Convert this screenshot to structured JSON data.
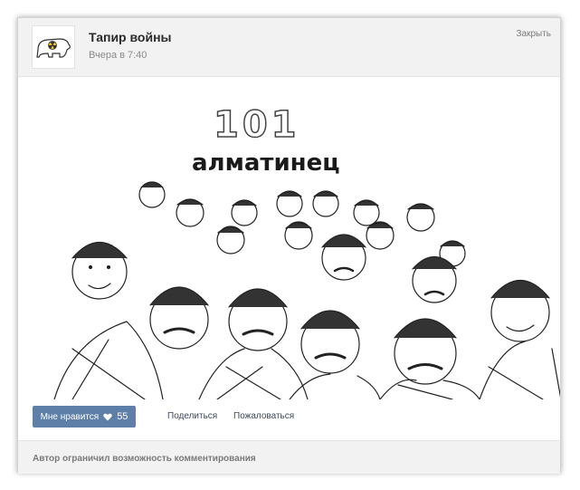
{
  "post": {
    "author": "Тапир войны",
    "time": "Вчера в 7:40",
    "close_label": "Закрыть"
  },
  "image": {
    "number": "101",
    "word": "алматинец"
  },
  "actions": {
    "like_label": "Мне нравится",
    "like_count": "55",
    "share_label": "Поделиться",
    "report_label": "Пожаловаться"
  },
  "footer": {
    "comments_disabled": "Автор ограничил возможность комментирования"
  },
  "colors": {
    "like_button": "#5d7fa8",
    "header_bg": "#f2f2f2"
  }
}
